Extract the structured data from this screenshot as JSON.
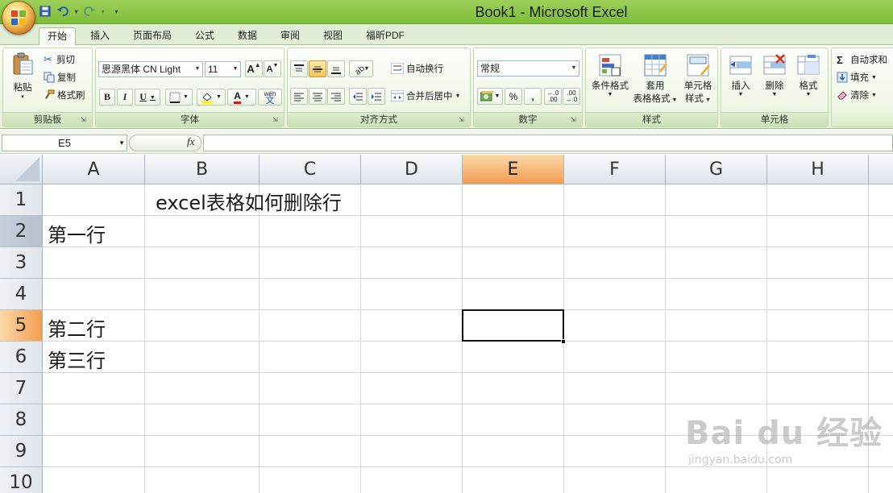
{
  "window": {
    "title": "Book1 - Microsoft Excel"
  },
  "qat": {
    "save_icon": "save-icon",
    "undo_icon": "undo-icon",
    "redo_icon": "redo-icon",
    "customize_icon": "customize-icon"
  },
  "tabs": [
    {
      "label": "开始",
      "active": true
    },
    {
      "label": "插入"
    },
    {
      "label": "页面布局"
    },
    {
      "label": "公式"
    },
    {
      "label": "数据"
    },
    {
      "label": "审阅"
    },
    {
      "label": "视图"
    },
    {
      "label": "福昕PDF"
    }
  ],
  "ribbon": {
    "clipboard": {
      "label": "剪贴板",
      "paste": "粘贴",
      "cut": "剪切",
      "copy": "复制",
      "format_painter": "格式刷"
    },
    "font": {
      "label": "字体",
      "font_name": "思源黑体 CN Light",
      "font_size": "11",
      "grow": "A",
      "shrink": "A",
      "bold": "B",
      "italic": "I",
      "underline": "U",
      "font_color_letter": "A",
      "phonetic_top": "wén",
      "phonetic_bottom": "文"
    },
    "alignment": {
      "label": "对齐方式",
      "wrap_text": "自动换行",
      "merge_center": "合并后居中"
    },
    "number": {
      "label": "数字",
      "format": "常规",
      "percent": "%",
      "comma": ",",
      "inc_decimal": ".00",
      "dec_decimal": ".00"
    },
    "styles": {
      "label": "样式",
      "conditional_1": "条件格式",
      "table_format_1": "套用",
      "table_format_2": "表格格式",
      "cell_styles_1": "单元格",
      "cell_styles_2": "样式"
    },
    "cells": {
      "label": "单元格",
      "insert": "插入",
      "delete": "删除",
      "format": "格式"
    },
    "editing": {
      "autosum": "自动求和",
      "fill": "填充",
      "clear": "清除"
    }
  },
  "formula_bar": {
    "name_box": "E5",
    "fx": "fx",
    "content": ""
  },
  "sheet": {
    "columns": [
      "A",
      "B",
      "C",
      "D",
      "E",
      "F",
      "G",
      "H"
    ],
    "rows": [
      "1",
      "2",
      "3",
      "4",
      "5",
      "6",
      "7",
      "8",
      "9",
      "10"
    ],
    "active_cell": "E5",
    "cells": {
      "B1": "excel表格如何删除行",
      "A2": "第一行",
      "A5": "第二行",
      "A6": "第三行"
    }
  },
  "watermark": {
    "logo": "Bai du 经验",
    "url": "jingyan.baidu.com"
  },
  "colors": {
    "titlebar": "#8cc648",
    "active_header": "#f49c52",
    "grid_line": "#d4d8dd"
  }
}
